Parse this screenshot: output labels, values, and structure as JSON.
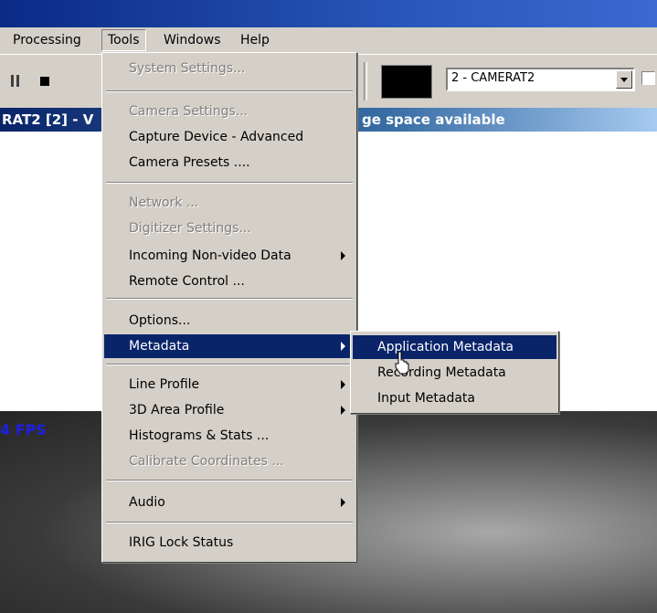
{
  "menubar": {
    "items": [
      {
        "label": "Processing"
      },
      {
        "label": "Tools"
      },
      {
        "label": "Windows"
      },
      {
        "label": "Help"
      }
    ]
  },
  "toolbar": {
    "pause_icon": "pause-icon",
    "stop_icon": "stop-icon",
    "color_swatch": "#000000",
    "camera_select": {
      "value": "2 - CAMERAT2"
    }
  },
  "window_title": {
    "left_text": "RAT2 [2] - V",
    "right_text": "ge space available"
  },
  "video": {
    "fps_text": "4 FPS"
  },
  "tools_menu": {
    "items": [
      {
        "label": "System Settings...",
        "enabled": false
      },
      {
        "label": "Camera Settings...",
        "enabled": false
      },
      {
        "label": "Capture Device - Advanced",
        "enabled": true
      },
      {
        "label": "Camera Presets ....",
        "enabled": true
      },
      {
        "label": "Network ...",
        "enabled": false
      },
      {
        "label": "Digitizer Settings...",
        "enabled": false
      },
      {
        "label": "Incoming Non-video Data",
        "enabled": true,
        "submenu": true
      },
      {
        "label": "Remote Control ...",
        "enabled": true
      },
      {
        "label": "Options...",
        "enabled": true
      },
      {
        "label": "Metadata",
        "enabled": true,
        "submenu": true,
        "highlighted": true
      },
      {
        "label": "Line Profile",
        "enabled": true,
        "submenu": true
      },
      {
        "label": "3D Area Profile",
        "enabled": true,
        "submenu": true
      },
      {
        "label": "Histograms & Stats ...",
        "enabled": true
      },
      {
        "label": "Calibrate Coordinates ...",
        "enabled": false
      },
      {
        "label": "Audio",
        "enabled": true,
        "submenu": true
      },
      {
        "label": "IRIG Lock Status",
        "enabled": true
      }
    ]
  },
  "metadata_submenu": {
    "items": [
      {
        "label": "Application Metadata",
        "highlighted": true
      },
      {
        "label": "Recording Metadata"
      },
      {
        "label": "Input Metadata"
      }
    ]
  },
  "colors": {
    "highlight": "#0a246a",
    "menu_bg": "#d4d0c8",
    "fps_text": "#1e1ee6"
  }
}
